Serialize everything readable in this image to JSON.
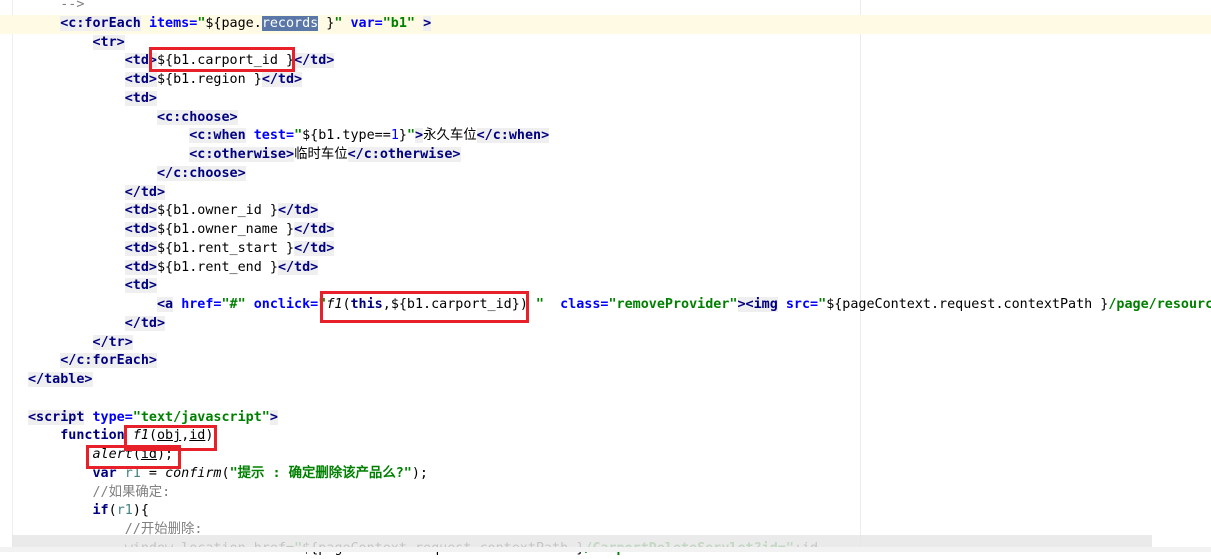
{
  "editor": {
    "current_line": 1,
    "lines": [
      {
        "indent": 4,
        "tokens": [
          [
            "cm",
            "-->"
          ]
        ]
      },
      {
        "indent": 4,
        "tokens": [
          [
            "tag",
            "<c:forEach"
          ],
          [
            "plain",
            " "
          ],
          [
            "attr",
            "items="
          ],
          [
            "str",
            "\""
          ],
          [
            "el",
            "${page."
          ],
          [
            "sel",
            "records"
          ],
          [
            "el",
            " }"
          ],
          [
            "str",
            "\""
          ],
          [
            "plain",
            " "
          ],
          [
            "attr",
            "var="
          ],
          [
            "str",
            "\"b1\""
          ],
          [
            "plain",
            " "
          ],
          [
            "tag",
            ">"
          ]
        ]
      },
      {
        "indent": 8,
        "tokens": [
          [
            "tag",
            "<tr>"
          ]
        ]
      },
      {
        "indent": 12,
        "tokens": [
          [
            "tag",
            "<td>"
          ],
          [
            "el",
            "${b1.carport_id }"
          ],
          [
            "tag",
            "</td>"
          ]
        ]
      },
      {
        "indent": 12,
        "tokens": [
          [
            "tag",
            "<td>"
          ],
          [
            "el",
            "${b1.region }"
          ],
          [
            "tag",
            "</td>"
          ]
        ]
      },
      {
        "indent": 12,
        "tokens": [
          [
            "tag",
            "<td>"
          ]
        ]
      },
      {
        "indent": 16,
        "tokens": [
          [
            "tag",
            "<c:choose>"
          ]
        ]
      },
      {
        "indent": 20,
        "tokens": [
          [
            "tag",
            "<c:when"
          ],
          [
            "plain",
            " "
          ],
          [
            "attr",
            "test="
          ],
          [
            "str",
            "\""
          ],
          [
            "el",
            "${b1.type=="
          ],
          [
            "num",
            "1"
          ],
          [
            "el",
            "}"
          ],
          [
            "str",
            "\""
          ],
          [
            "tag",
            ">"
          ],
          [
            "plain",
            "永久车位"
          ],
          [
            "tag",
            "</c:when>"
          ]
        ]
      },
      {
        "indent": 20,
        "tokens": [
          [
            "tag",
            "<c:otherwise>"
          ],
          [
            "plain",
            "临时车位"
          ],
          [
            "tag",
            "</c:otherwise>"
          ]
        ]
      },
      {
        "indent": 16,
        "tokens": [
          [
            "tag",
            "</c:choose>"
          ]
        ]
      },
      {
        "indent": 12,
        "tokens": [
          [
            "tag",
            "</td>"
          ]
        ]
      },
      {
        "indent": 12,
        "tokens": [
          [
            "tag",
            "<td>"
          ],
          [
            "el",
            "${b1.owner_id }"
          ],
          [
            "tag",
            "</td>"
          ]
        ]
      },
      {
        "indent": 12,
        "tokens": [
          [
            "tag",
            "<td>"
          ],
          [
            "el",
            "${b1.owner_name }"
          ],
          [
            "tag",
            "</td>"
          ]
        ]
      },
      {
        "indent": 12,
        "tokens": [
          [
            "tag",
            "<td>"
          ],
          [
            "el",
            "${b1.rent_start }"
          ],
          [
            "tag",
            "</td>"
          ]
        ]
      },
      {
        "indent": 12,
        "tokens": [
          [
            "tag",
            "<td>"
          ],
          [
            "el",
            "${b1.rent_end }"
          ],
          [
            "tag",
            "</td>"
          ]
        ]
      },
      {
        "indent": 12,
        "tokens": [
          [
            "tag",
            "<td>"
          ]
        ]
      },
      {
        "indent": 16,
        "tokens": [
          [
            "tag",
            "<a"
          ],
          [
            "plain",
            " "
          ],
          [
            "attr",
            "href="
          ],
          [
            "str",
            "\"#\""
          ],
          [
            "plain",
            " "
          ],
          [
            "attr",
            "onclick="
          ],
          [
            "str",
            "\""
          ],
          [
            "fn",
            "f1"
          ],
          [
            "plain",
            "("
          ],
          [
            "kw",
            "this"
          ],
          [
            "plain",
            ","
          ],
          [
            "el",
            "${b1.carport_id}"
          ],
          [
            "plain",
            ")"
          ],
          [
            "str",
            " \""
          ],
          [
            "plain",
            "  "
          ],
          [
            "attr",
            "class="
          ],
          [
            "str",
            "\"removeProvider\""
          ],
          [
            "tag",
            "><img"
          ],
          [
            "plain",
            " "
          ],
          [
            "attr",
            "src="
          ],
          [
            "str",
            "\""
          ],
          [
            "el",
            "${pageContext.request.contextPath }"
          ],
          [
            "str",
            "/page/resources"
          ]
        ]
      },
      {
        "indent": 12,
        "tokens": [
          [
            "tag",
            "</td>"
          ]
        ]
      },
      {
        "indent": 8,
        "tokens": [
          [
            "tag",
            "</tr>"
          ]
        ]
      },
      {
        "indent": 4,
        "tokens": [
          [
            "tag",
            "</c:forEach>"
          ]
        ]
      },
      {
        "indent": 0,
        "tokens": [
          [
            "tag",
            "</table>"
          ]
        ]
      },
      {
        "indent": 0,
        "tokens": []
      },
      {
        "indent": 0,
        "tokens": [
          [
            "tag",
            "<script"
          ],
          [
            "plain",
            " "
          ],
          [
            "attr",
            "type="
          ],
          [
            "str",
            "\"text/javascript\""
          ],
          [
            "tag",
            ">"
          ]
        ]
      },
      {
        "indent": 4,
        "tokens": [
          [
            "kw",
            "function"
          ],
          [
            "plain",
            " "
          ],
          [
            "fn",
            "f1"
          ],
          [
            "plain",
            "("
          ],
          [
            "ul",
            "obj"
          ],
          [
            "plain",
            ","
          ],
          [
            "ul",
            "id"
          ],
          [
            "plain",
            ")"
          ]
        ]
      },
      {
        "indent": 8,
        "tokens": [
          [
            "fn",
            "alert"
          ],
          [
            "plain",
            "("
          ],
          [
            "ul",
            "id"
          ],
          [
            "plain",
            ");"
          ]
        ]
      },
      {
        "indent": 8,
        "tokens": [
          [
            "kw",
            "var"
          ],
          [
            "plain",
            " "
          ],
          [
            "var",
            "r1"
          ],
          [
            "plain",
            " = "
          ],
          [
            "fn",
            "confirm"
          ],
          [
            "plain",
            "("
          ],
          [
            "str",
            "\"提示 : 确定删除该产品么?\""
          ],
          [
            "plain",
            ");"
          ]
        ]
      },
      {
        "indent": 8,
        "tokens": [
          [
            "cm",
            "//如果确定:"
          ]
        ]
      },
      {
        "indent": 8,
        "tokens": [
          [
            "kw",
            "if"
          ],
          [
            "plain",
            "("
          ],
          [
            "var",
            "r1"
          ],
          [
            "plain",
            "){"
          ]
        ]
      },
      {
        "indent": 12,
        "tokens": [
          [
            "cm",
            "//开始删除:"
          ]
        ]
      },
      {
        "indent": 12,
        "tokens": [
          [
            "plain",
            "window.location.href="
          ],
          [
            "str",
            "\""
          ],
          [
            "el",
            "${pageContext.request.contextPath }"
          ],
          [
            "str",
            "/CarportDeleteServlet?id=\""
          ],
          [
            "plain",
            "+id"
          ]
        ]
      }
    ]
  },
  "annotations": {
    "color": "#e8202a"
  }
}
